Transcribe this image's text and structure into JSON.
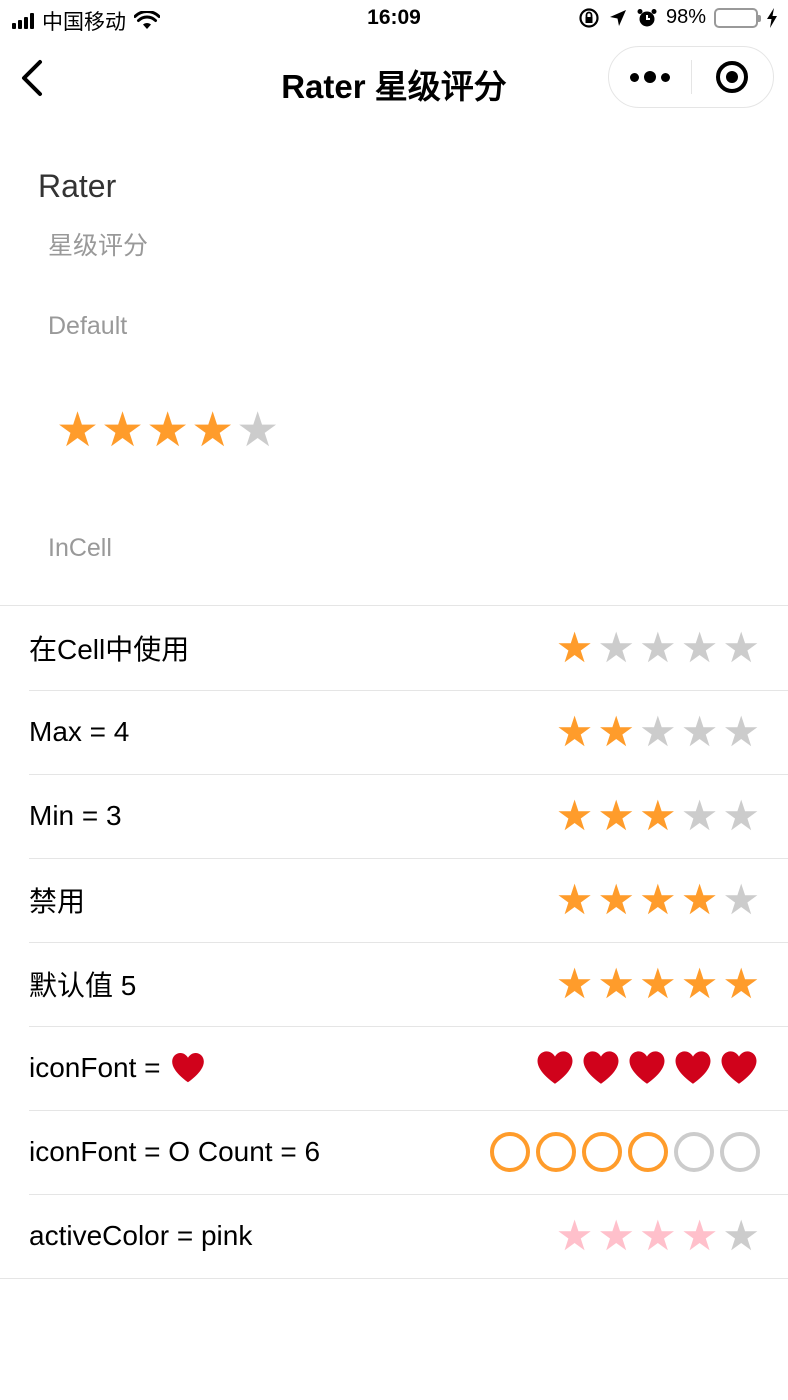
{
  "status_bar": {
    "carrier": "中国移动",
    "time": "16:09",
    "battery": "98%"
  },
  "nav": {
    "title": "Rater 星级评分"
  },
  "page": {
    "title": "Rater",
    "subtitle": "星级评分",
    "section_default": "Default",
    "section_incell": "InCell"
  },
  "colors": {
    "active": "#ff9c2b",
    "inactive": "#cccccc",
    "pink": "#ffc0cb",
    "heart": "#d0021b"
  },
  "default_rater": {
    "value": 4,
    "max": 5,
    "icon": "star-icon"
  },
  "cells": [
    {
      "label": "在Cell中使用",
      "value": 1,
      "max": 5,
      "icon": "star-icon",
      "active_color": "active"
    },
    {
      "label": "Max = 4",
      "value": 2,
      "max": 5,
      "icon": "star-icon",
      "active_color": "active"
    },
    {
      "label": "Min = 3",
      "value": 3,
      "max": 5,
      "icon": "star-icon",
      "active_color": "active"
    },
    {
      "label": "禁用",
      "value": 4,
      "max": 5,
      "icon": "star-icon",
      "active_color": "active"
    },
    {
      "label": "默认值 5",
      "value": 5,
      "max": 5,
      "icon": "star-icon",
      "active_color": "active"
    },
    {
      "label": "iconFont = ",
      "label_icon": "heart-icon",
      "value": 5,
      "max": 5,
      "icon": "heart-icon",
      "active_color": "heart"
    },
    {
      "label": "iconFont = O Count = 6",
      "value": 4,
      "max": 6,
      "icon": "circle-icon",
      "active_color": "active"
    },
    {
      "label": "activeColor = pink",
      "value": 4,
      "max": 5,
      "icon": "star-icon",
      "active_color": "pink"
    }
  ]
}
